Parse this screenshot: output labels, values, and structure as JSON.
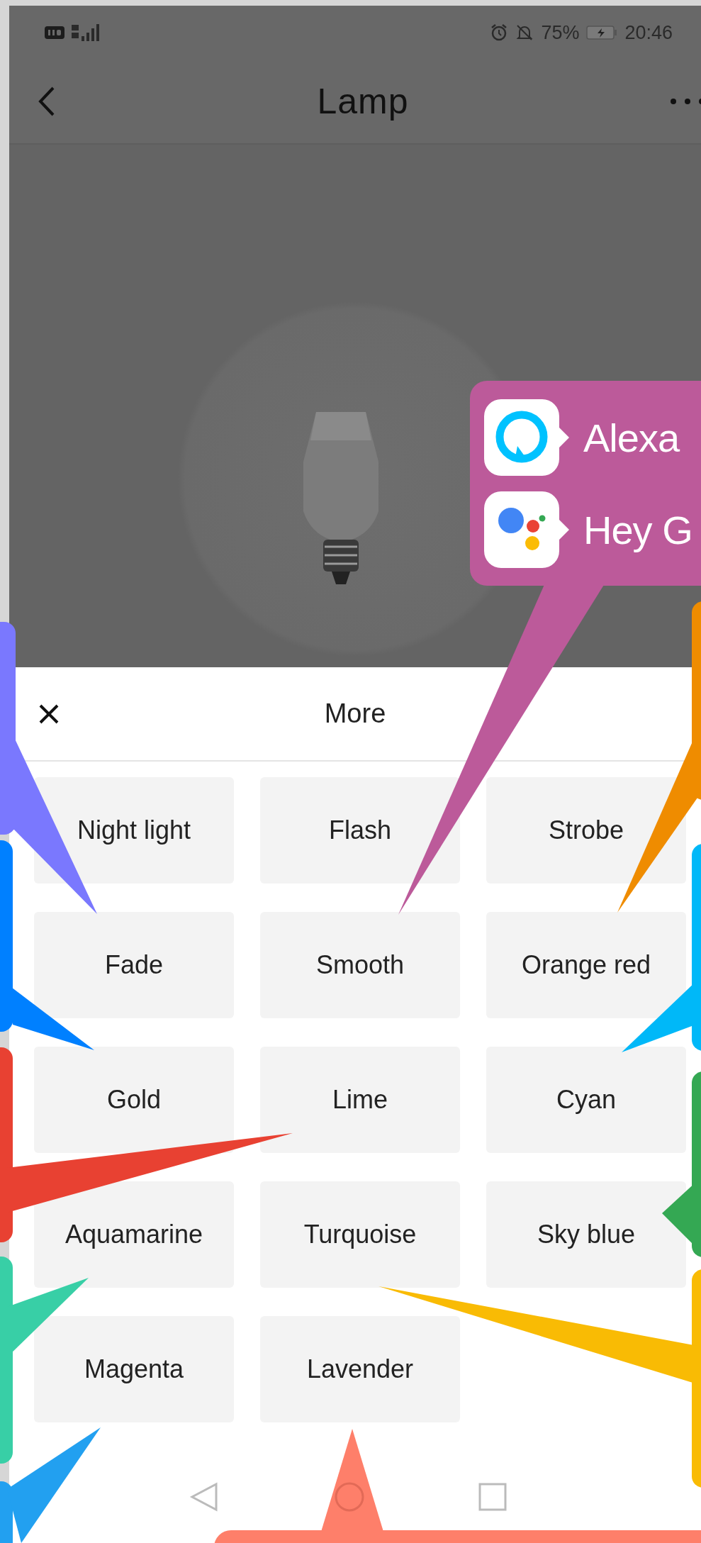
{
  "status_bar": {
    "battery": "75%",
    "time": "20:46"
  },
  "header": {
    "title": "Lamp"
  },
  "sheet": {
    "title": "More",
    "options": [
      {
        "label": "Night light"
      },
      {
        "label": "Flash"
      },
      {
        "label": "Strobe"
      },
      {
        "label": "Fade"
      },
      {
        "label": "Smooth"
      },
      {
        "label": "Orange red"
      },
      {
        "label": "Gold"
      },
      {
        "label": "Lime"
      },
      {
        "label": "Cyan"
      },
      {
        "label": "Aquamarine"
      },
      {
        "label": "Turquoise"
      },
      {
        "label": "Sky blue"
      },
      {
        "label": "Magenta"
      },
      {
        "label": "Lavender"
      }
    ]
  },
  "callouts": [
    {
      "color": "#bc5a9a",
      "items": [
        {
          "label": "Alexa"
        },
        {
          "label": "Hey G"
        }
      ]
    },
    {
      "color": "#7a78fe"
    },
    {
      "color": "#0080ff"
    },
    {
      "color": "#e84132"
    },
    {
      "color": "#38cfa6"
    },
    {
      "color": "#22a0f0"
    },
    {
      "color": "#ef8c00"
    },
    {
      "color": "#00b8f8"
    },
    {
      "color": "#34a853"
    },
    {
      "color": "#f9bb04"
    },
    {
      "color": "#fe7f6a"
    }
  ]
}
